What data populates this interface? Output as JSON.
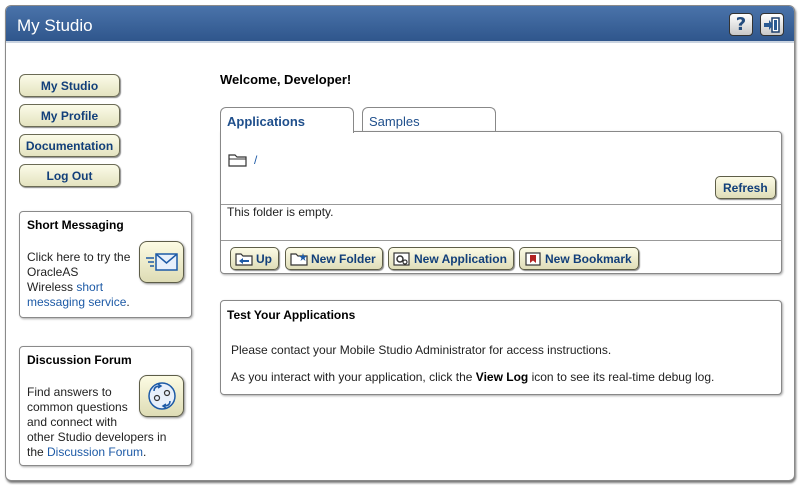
{
  "window": {
    "title": "My Studio"
  },
  "titlebar": {
    "help_icon": "help-icon",
    "exit_icon": "exit-icon"
  },
  "nav": [
    {
      "label": "My Studio"
    },
    {
      "label": "My Profile"
    },
    {
      "label": "Documentation"
    },
    {
      "label": "Log Out"
    }
  ],
  "short_messaging": {
    "heading": "Short Messaging",
    "line1": "Click here to try the",
    "line2": "OracleAS",
    "line3_text": "Wireless ",
    "link1": "short",
    "link2": "messaging service",
    "tail": ".",
    "icon": "envelope-icon"
  },
  "discussion": {
    "heading": "Discussion Forum",
    "line1": "Find answers to",
    "line2": "common questions",
    "line3": "and connect with",
    "line4": "other Studio developers in",
    "line5_text": "the ",
    "link": "Discussion Forum",
    "tail": ".",
    "icon": "forum-icon"
  },
  "main": {
    "welcome": "Welcome, Developer!",
    "tabs": [
      {
        "label": "Applications",
        "active": true
      },
      {
        "label": "Samples",
        "active": false
      }
    ],
    "path": "/",
    "refresh_label": "Refresh",
    "empty_message": "This folder is empty.",
    "buttons": {
      "up": "Up",
      "new_folder": "New Folder",
      "new_application": "New Application",
      "new_bookmark": "New Bookmark"
    }
  },
  "test": {
    "heading": "Test Your Applications",
    "p1": "Please contact your Mobile Studio Administrator for access instructions.",
    "p2_pre": "As you interact with your application, click the ",
    "p2_bold": "View Log",
    "p2_post": " icon to see its real-time debug log."
  },
  "colors": {
    "titlebar": "#3a639b",
    "link": "#1d5aa6",
    "button_text": "#123f7a"
  }
}
